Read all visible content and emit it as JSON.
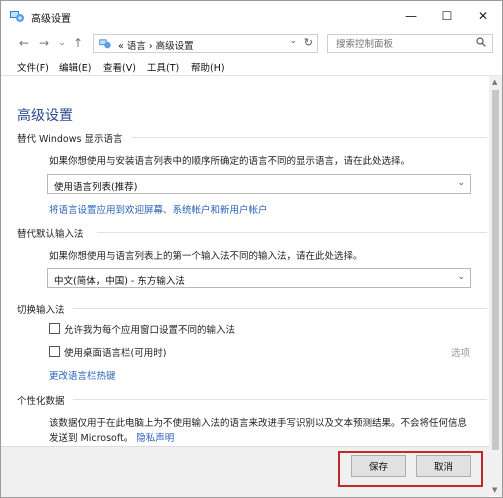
{
  "window": {
    "title": "高级设置",
    "minimize": "—",
    "maximize": "☐",
    "close": "✕"
  },
  "nav": {
    "back": "←",
    "forward": "→",
    "dropdown": "⌄",
    "up": "↑",
    "breadcrumb": "«  语言  ›  高级设置",
    "address_dropdown": "⌄",
    "refresh": "↻",
    "search_placeholder": "搜索控制面板"
  },
  "menu": {
    "file": "文件(F)",
    "edit": "编辑(E)",
    "view": "查看(V)",
    "tools": "工具(T)",
    "help": "帮助(H)"
  },
  "main": {
    "heading": "高级设置",
    "display_language": {
      "title": "替代 Windows 显示语言",
      "description": "如果你想使用与安装语言列表中的顺序所确定的语言不同的显示语言，请在此处选择。",
      "selected": "使用语言列表(推荐)",
      "apply_link": "将语言设置应用到欢迎屏幕、系统帐户和新用户帐户"
    },
    "default_input": {
      "title": "替代默认输入法",
      "description": "如果你想使用与语言列表上的第一个输入法不同的输入法，请在此处选择。",
      "selected": "中文(简体，中国) - 东方输入法"
    },
    "switch_input": {
      "title": "切换输入法",
      "checkbox1": "允许我为每个应用窗口设置不同的输入法",
      "checkbox2": "使用桌面语言栏(可用时)",
      "options": "选项",
      "hotkey_link": "更改语言栏热键"
    },
    "personalization": {
      "title": "个性化数据",
      "description_line1": "该数据仅用于在此电脑上为不使用输入法的语言来改进手写识别以及文本预测结果。不会将任何信息",
      "description_line2": "发送到 Microsoft。",
      "privacy_link": "隐私声明"
    }
  },
  "footer": {
    "save": "保存",
    "cancel": "取消"
  },
  "colors": {
    "heading": "#2c4a8f",
    "link": "#2a63b8",
    "highlight": "#c0282d"
  }
}
